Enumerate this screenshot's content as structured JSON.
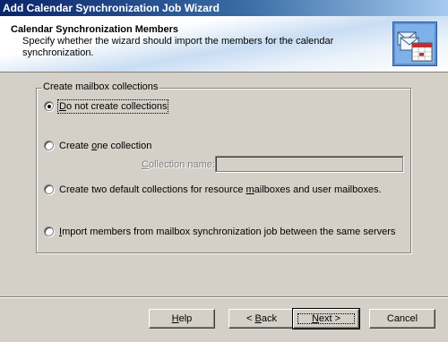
{
  "window": {
    "title": "Add Calendar Synchronization Job Wizard"
  },
  "header": {
    "title": "Calendar Synchronization Members",
    "description": "Specify whether the wizard should import the members for the calendar synchronization.",
    "icon": "calendar-envelope-icon"
  },
  "group": {
    "legend": "Create mailbox collections",
    "options": [
      {
        "label_pre": "",
        "label_u": "D",
        "label_post": "o not create collections",
        "checked": true
      },
      {
        "label_pre": "Create ",
        "label_u": "o",
        "label_post": "ne collection",
        "checked": false
      },
      {
        "label_pre": "Create two default collections for resource ",
        "label_u": "m",
        "label_post": "ailboxes and user mailboxes.",
        "checked": false
      },
      {
        "label_pre": "",
        "label_u": "I",
        "label_post": "mport members from mailbox synchronization job between the same servers",
        "checked": false
      }
    ],
    "collection_name_label_u": "C",
    "collection_name_label_post": "ollection name:",
    "collection_name_value": ""
  },
  "buttons": {
    "help_u": "H",
    "help_post": "elp",
    "back_pre": "< ",
    "back_u": "B",
    "back_post": "ack",
    "next_u": "N",
    "next_post": "ext >",
    "cancel": "Cancel"
  }
}
